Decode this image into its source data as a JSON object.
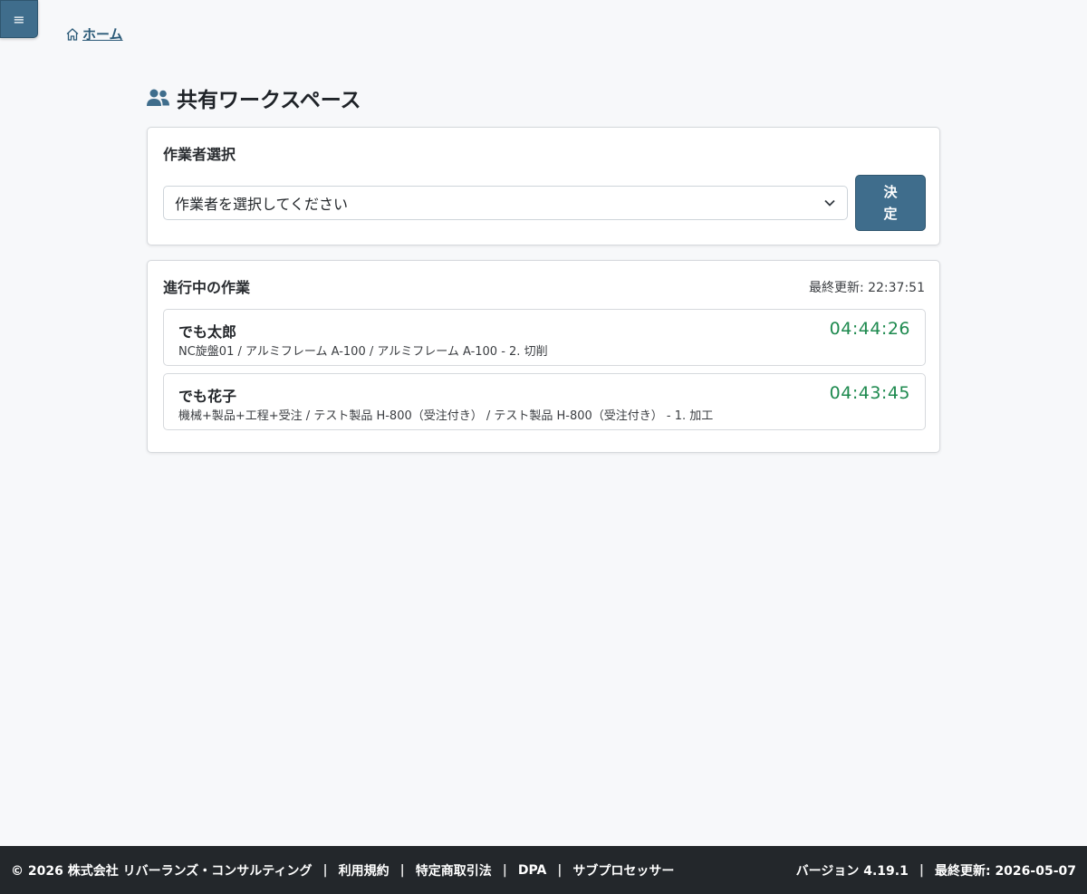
{
  "menu": {
    "icon_glyph": "≡"
  },
  "breadcrumb": {
    "home_label": "ホーム"
  },
  "page": {
    "title": "共有ワークスペース"
  },
  "worker_select": {
    "heading": "作業者選択",
    "select_value": "作業者を選択してください",
    "decide_label_line1": "決",
    "decide_label_line2": "定"
  },
  "in_progress": {
    "heading": "進行中の作業",
    "last_updated": "最終更新: 22:37:51",
    "items": [
      {
        "name": "でも太郎",
        "description": "NC旋盤01 / アルミフレーム A-100 / アルミフレーム A-100 - 2. 切削",
        "elapsed": "04:44:26"
      },
      {
        "name": "でも花子",
        "description": "機械+製品+工程+受注 / テスト製品 H-800（受注付き） / テスト製品 H-800（受注付き） - 1. 加工",
        "elapsed": "04:43:45"
      }
    ]
  },
  "footer": {
    "copyright": "© 2026 株式会社 リバーランズ・コンサルティング",
    "terms": "利用規約",
    "commerce_law": "特定商取引法",
    "dpa": "DPA",
    "subprocessors": "サブプロセッサー",
    "version": "バージョン 4.19.1",
    "last_updated": "最終更新: 2026-05-07",
    "separator": "|"
  },
  "colors": {
    "accent": "#3f6d8c",
    "timer_green": "#1e8a4f",
    "footer_bg": "#23272b",
    "page_bg": "#f7f8fa"
  },
  "icons": {
    "menu": "hamburger-icon",
    "home": "home-icon",
    "title": "users-icon",
    "select": "chevron-down-icon"
  }
}
